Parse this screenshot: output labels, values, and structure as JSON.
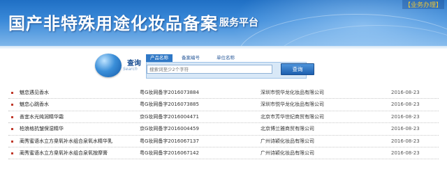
{
  "header": {
    "title": "国产非特殊用途化妆品备案",
    "subtitle": "服务平台",
    "top_link": "【业务办理】"
  },
  "search": {
    "section_title": "查询",
    "section_subtitle": "Search",
    "tabs": [
      {
        "label": "产品名称",
        "active": true
      },
      {
        "label": "备案编号",
        "active": false
      },
      {
        "label": "单位名称",
        "active": false
      }
    ],
    "placeholder": "搜索词至少2个字符",
    "button_label": "查询"
  },
  "records": [
    {
      "name": "魅恋遇见香水",
      "code": "粤G妆网备字2016073884",
      "company": "深圳市悦华龙化妆品有限公司",
      "date": "2016-08-23"
    },
    {
      "name": "魅恋心跳香水",
      "code": "粤G妆网备字2016073885",
      "company": "深圳市悦华龙化妆品有限公司",
      "date": "2016-08-23"
    },
    {
      "name": "善宜水光纯润精华霜",
      "code": "京G妆网备字2016004471",
      "company": "北京市芳华世纪商贸有限公司",
      "date": "2016-08-23"
    },
    {
      "name": "柏浪格抗皱保湿精华",
      "code": "京G妆网备字2016004459",
      "company": "北京博兰雅商贸有限公司",
      "date": "2016-08-23"
    },
    {
      "name": "蔺秀蜜语水立方臬氧补水组合泉氧水精华乳",
      "code": "粤G妆网备字2016067137",
      "company": "广州诗颖化妆品有限公司",
      "date": "2016-08-23"
    },
    {
      "name": "蔺秀蜜语水立方臬氧补水组合泉氧按摩膏",
      "code": "粤G妆网备字2016067142",
      "company": "广州诗颖化妆品有限公司",
      "date": "2016-08-23"
    }
  ]
}
